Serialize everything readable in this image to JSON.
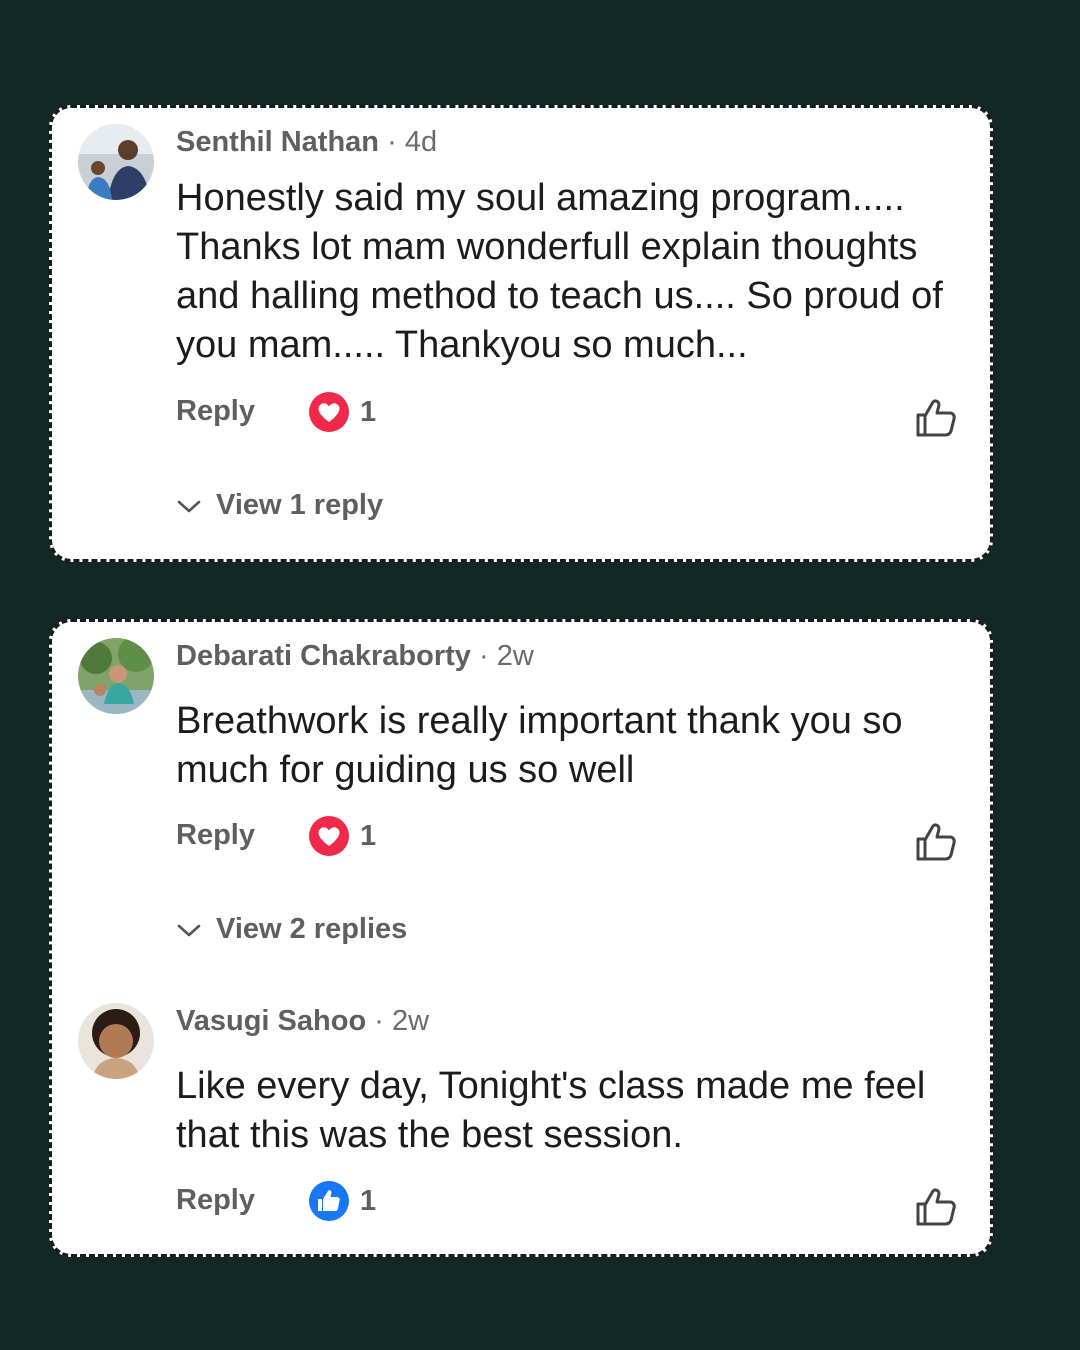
{
  "comments": [
    {
      "author": "Senthil Nathan",
      "separator": "·",
      "time": "4d",
      "text": "Honestly said my soul amazing program..... Thanks lot mam wonderfull explain thoughts and halling method to teach us.... So proud of you mam..... Thankyou so much...",
      "reply_label": "Reply",
      "reaction_type": "love",
      "reaction_count": "1",
      "view_replies": "View 1 reply",
      "like_icon": "thumbs-up-outline-icon"
    },
    {
      "author": "Debarati Chakraborty",
      "separator": "·",
      "time": "2w",
      "text": "Breathwork is really important thank you so much for guiding us so well",
      "reply_label": "Reply",
      "reaction_type": "love",
      "reaction_count": "1",
      "view_replies": "View 2 replies",
      "like_icon": "thumbs-up-outline-icon"
    },
    {
      "author": "Vasugi Sahoo",
      "separator": "·",
      "time": "2w",
      "text": "Like every day, Tonight's class made me feel that this was the best session.",
      "reply_label": "Reply",
      "reaction_type": "like",
      "reaction_count": "1",
      "like_icon": "thumbs-up-outline-icon"
    }
  ],
  "colors": {
    "background": "#122824",
    "card": "#ffffff",
    "love_reaction": "#f0284a",
    "like_reaction": "#1877f2",
    "meta_text": "#5f5f5f",
    "body_text": "#1c1c1c"
  }
}
